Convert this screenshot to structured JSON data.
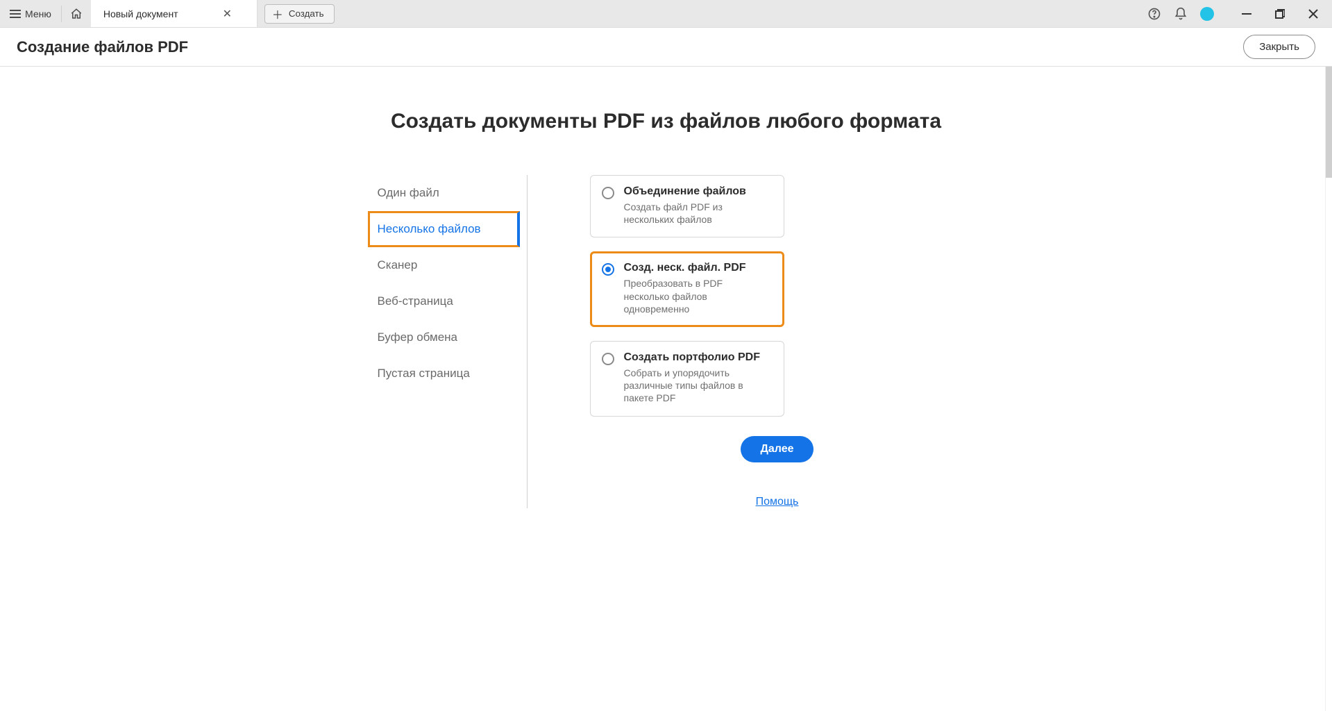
{
  "titlebar": {
    "menu_label": "Меню",
    "tab_label": "Новый документ",
    "create_label": "Создать"
  },
  "subheader": {
    "title": "Создание файлов PDF",
    "close_label": "Закрыть"
  },
  "hero": "Создать документы PDF из файлов любого формата",
  "leftnav": {
    "items": [
      "Один файл",
      "Несколько файлов",
      "Сканер",
      "Веб-страница",
      "Буфер обмена",
      "Пустая страница"
    ],
    "active_index": 1
  },
  "cards": [
    {
      "title": "Объединение файлов",
      "desc": "Создать файл PDF из нескольких файлов",
      "checked": false,
      "highlight": false
    },
    {
      "title": "Созд. неск. файл. PDF",
      "desc": "Преобразовать в PDF несколько файлов одновременно",
      "checked": true,
      "highlight": true
    },
    {
      "title": "Создать портфолио PDF",
      "desc": "Собрать и упорядочить различные типы файлов в пакете PDF",
      "checked": false,
      "highlight": false
    }
  ],
  "buttons": {
    "next": "Далее",
    "help": "Помощь"
  }
}
